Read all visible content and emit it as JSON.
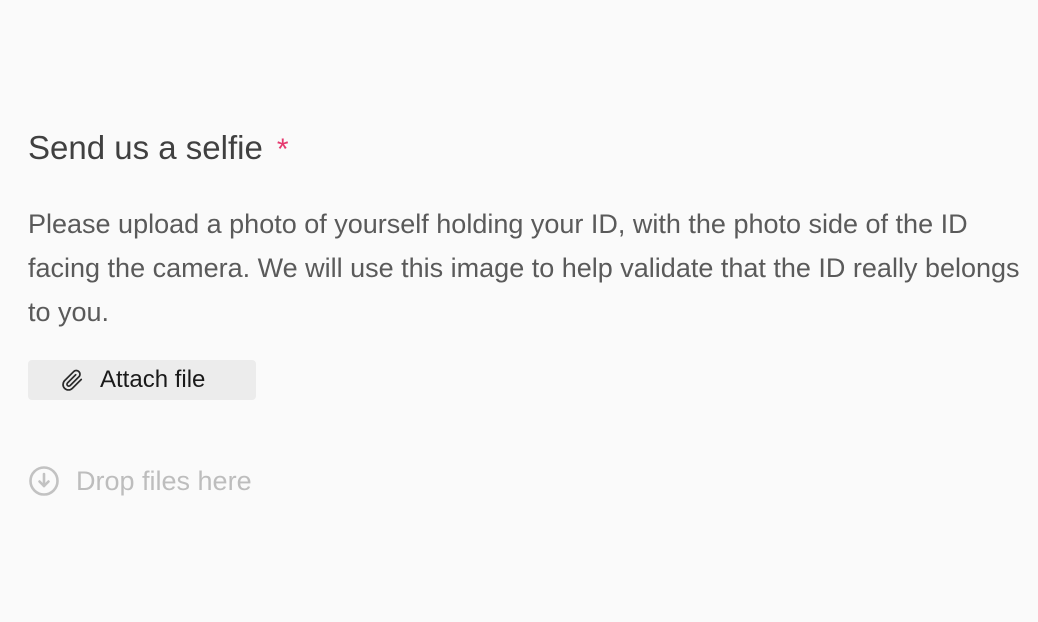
{
  "question": {
    "title": "Send us a selfie",
    "required_marker": "*",
    "description": "Please upload a photo of yourself holding your ID, with the photo side of the ID facing the camera.  We will use this image to help validate that the ID really belongs to you."
  },
  "attach": {
    "label": "Attach file",
    "icon": "paperclip-icon"
  },
  "drop": {
    "label": "Drop files here",
    "icon": "download-circle-icon"
  },
  "colors": {
    "background": "#fafafa",
    "required": "#e5396e",
    "button_bg": "#ececec",
    "muted": "#bdbdbd"
  }
}
